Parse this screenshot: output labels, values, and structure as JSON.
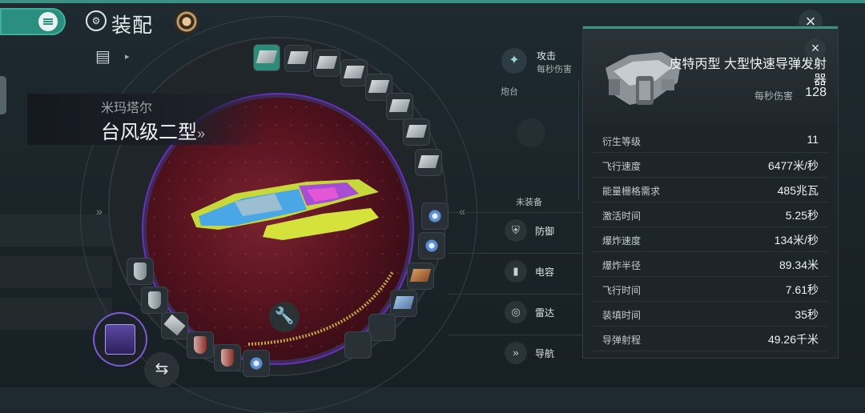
{
  "header": {
    "title": "装配",
    "menu_icon": "hamburger-icon",
    "title_icon": "helmet-icon",
    "close_icon": "close-icon"
  },
  "ship": {
    "faction": "米玛塔尔",
    "name": "台风级二型",
    "name_suffix": "»"
  },
  "right_panel": {
    "attack_label": "攻击",
    "attack_sub": "每秒伤害",
    "turret_header": "炮台",
    "unequipped_label": "未装备",
    "categories": [
      {
        "label": "防御",
        "icon": "shield-icon"
      },
      {
        "label": "电容",
        "icon": "battery-icon"
      },
      {
        "label": "雷达",
        "icon": "radar-icon"
      },
      {
        "label": "导航",
        "icon": "navigation-icon"
      }
    ]
  },
  "detail_card": {
    "name": "皮特丙型 大型快速导弹发射器",
    "dps_label": "每秒伤害",
    "dps_value": "128",
    "stats": [
      {
        "key": "衍生等级",
        "value": "11"
      },
      {
        "key": "飞行速度",
        "value": "6477米/秒"
      },
      {
        "key": "能量栅格需求",
        "value": "485兆瓦"
      },
      {
        "key": "激活时间",
        "value": "5.25秒"
      },
      {
        "key": "爆炸速度",
        "value": "134米/秒"
      },
      {
        "key": "爆炸半径",
        "value": "89.34米"
      },
      {
        "key": "飞行时间",
        "value": "7.61秒"
      },
      {
        "key": "装填时间",
        "value": "35秒"
      },
      {
        "key": "导弹射程",
        "value": "49.26千米"
      }
    ]
  },
  "colors": {
    "accent": "#2d8b79",
    "ring_purple": "#6a2fbf",
    "inner_red": "#5a1420"
  }
}
